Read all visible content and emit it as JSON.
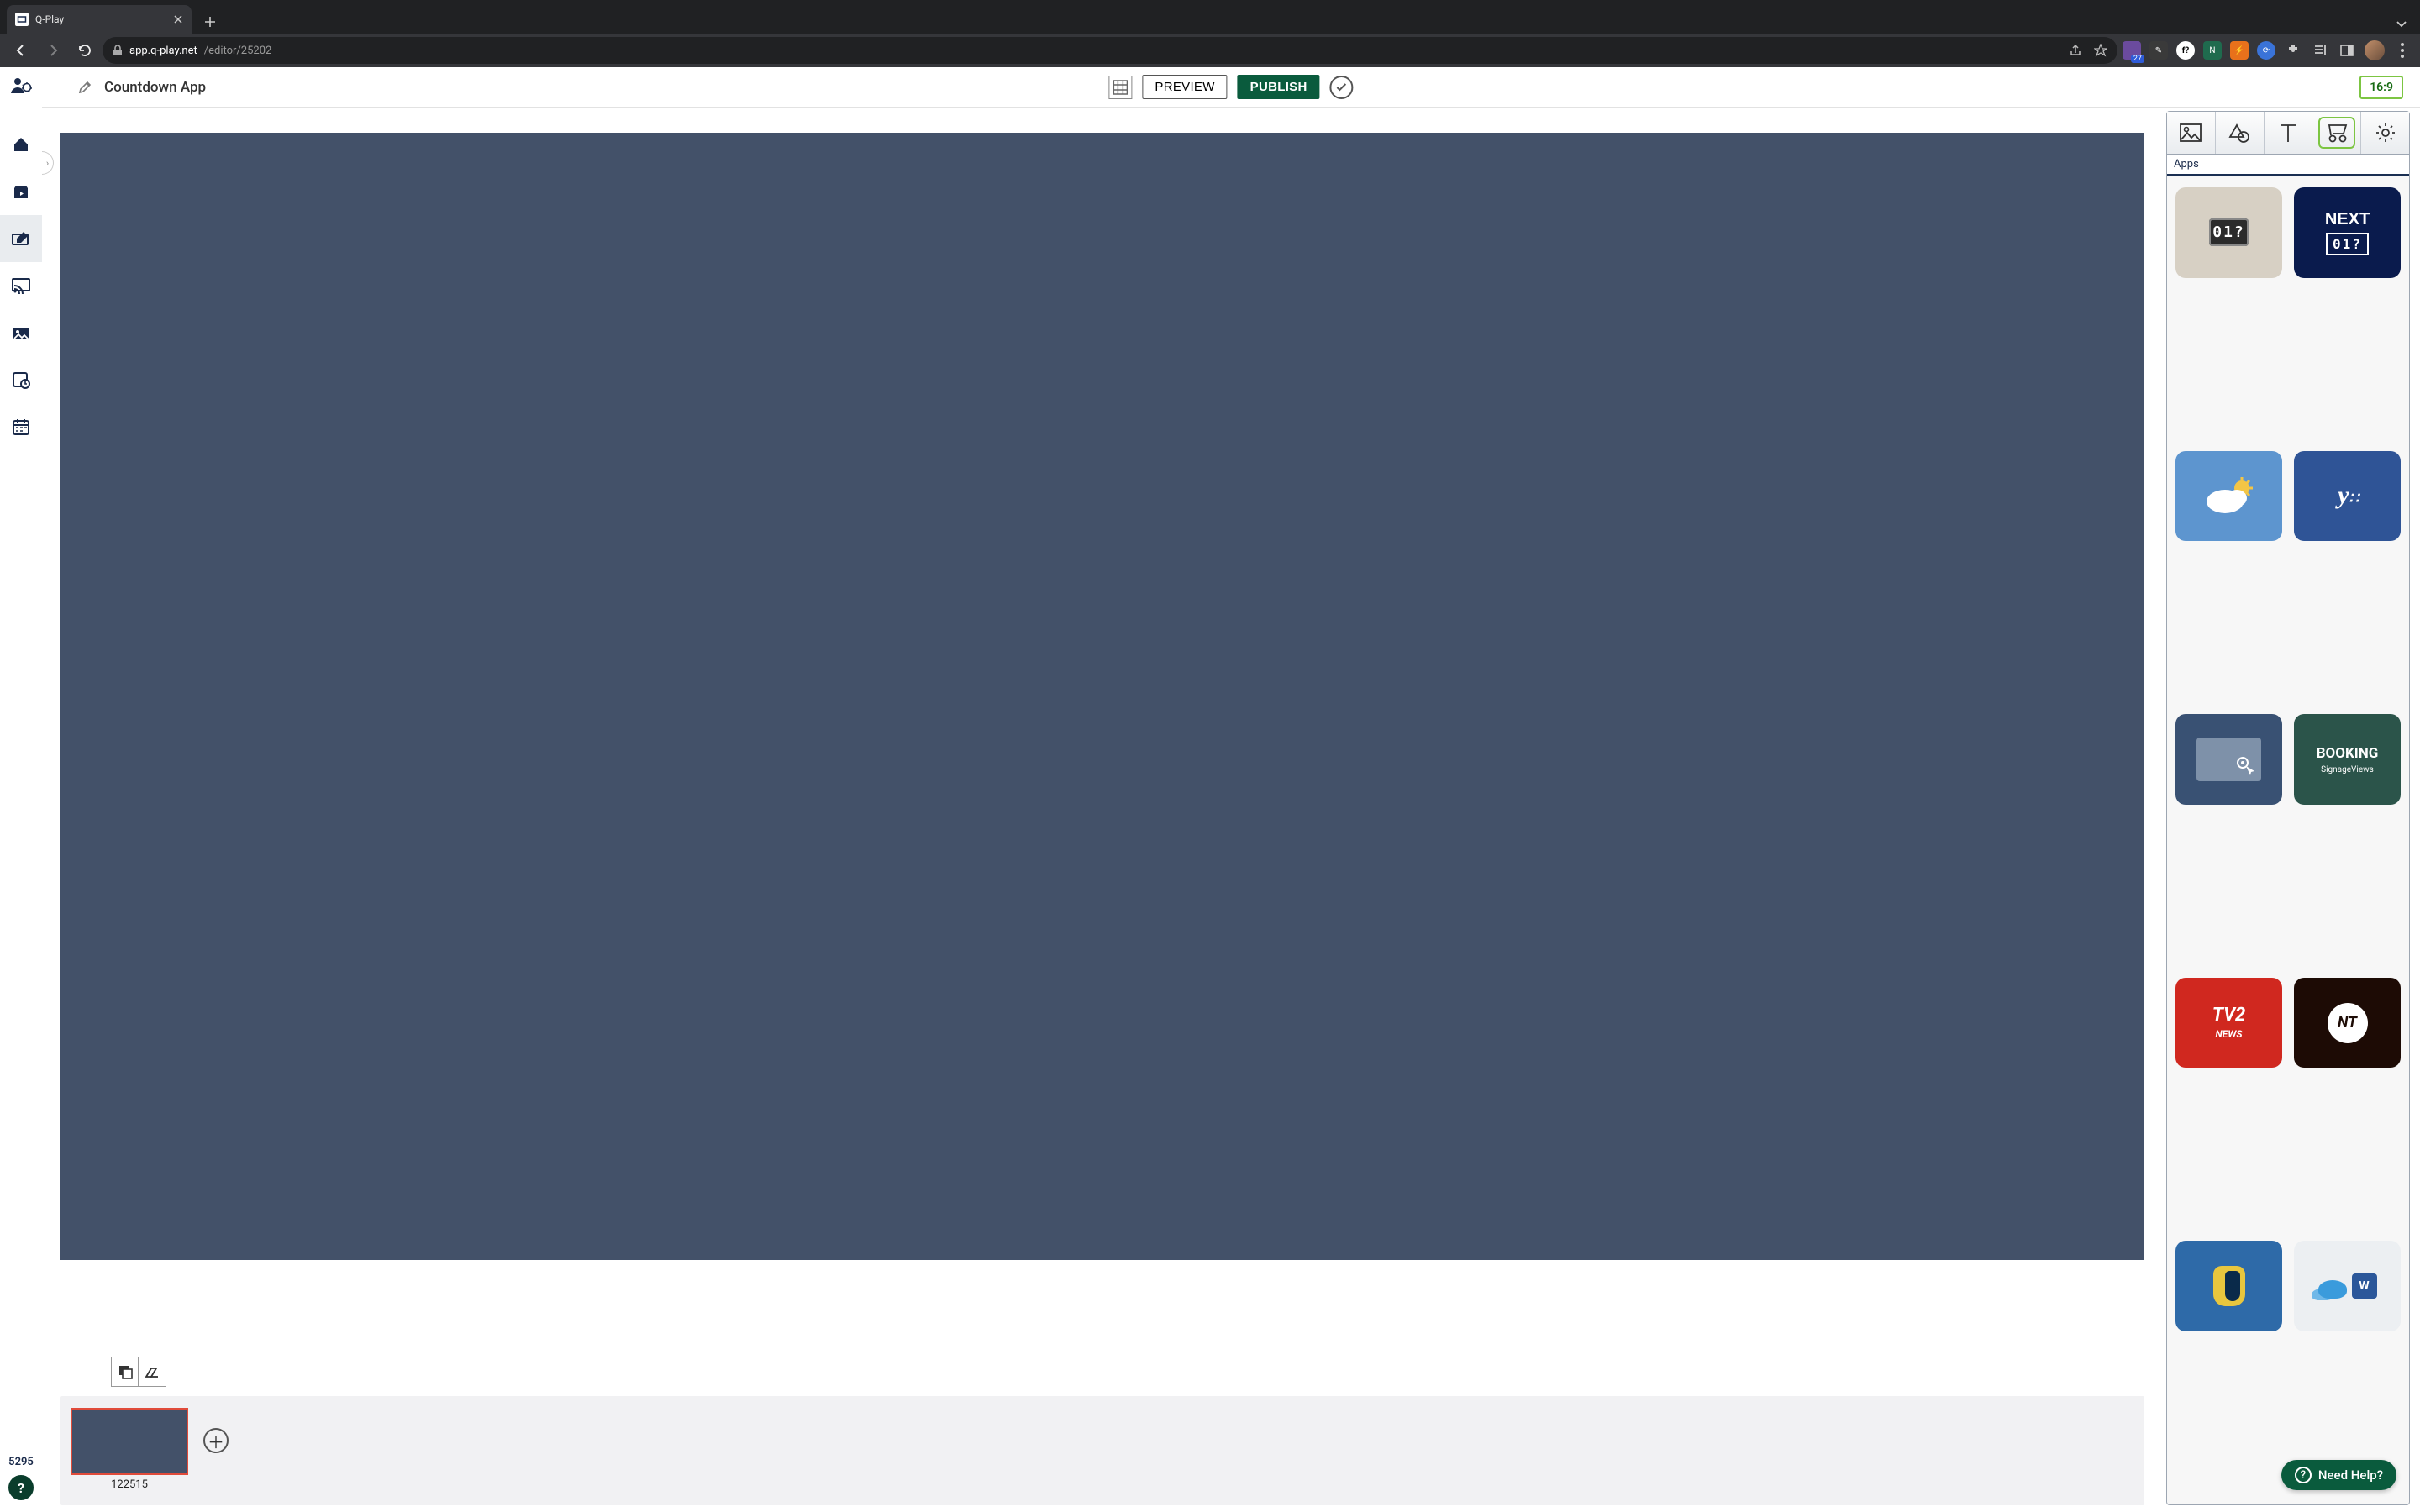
{
  "browser": {
    "tab_title": "Q-Play",
    "url_host": "app.q-play.net",
    "url_path": "/editor/25202",
    "ext_badge": "27"
  },
  "rail": {
    "session_id": "5295"
  },
  "topbar": {
    "title": "Countdown App",
    "preview_label": "PREVIEW",
    "publish_label": "PUBLISH",
    "aspect_label": "16:9"
  },
  "panel": {
    "section_title": "Apps",
    "tiles": {
      "counter_digits": "01?",
      "next_label": "NEXT",
      "next_digits": "01?",
      "yammer_glyph": "y⋮",
      "booking_line1": "BOOKING",
      "booking_line2": "SignageViews",
      "tv2_line1": "TV2",
      "tv2_line2": "NEWS",
      "nt_label": "NT",
      "word_label": "W"
    }
  },
  "thumbs": {
    "slide1_label": "122515"
  },
  "help": {
    "label": "Need Help?"
  }
}
